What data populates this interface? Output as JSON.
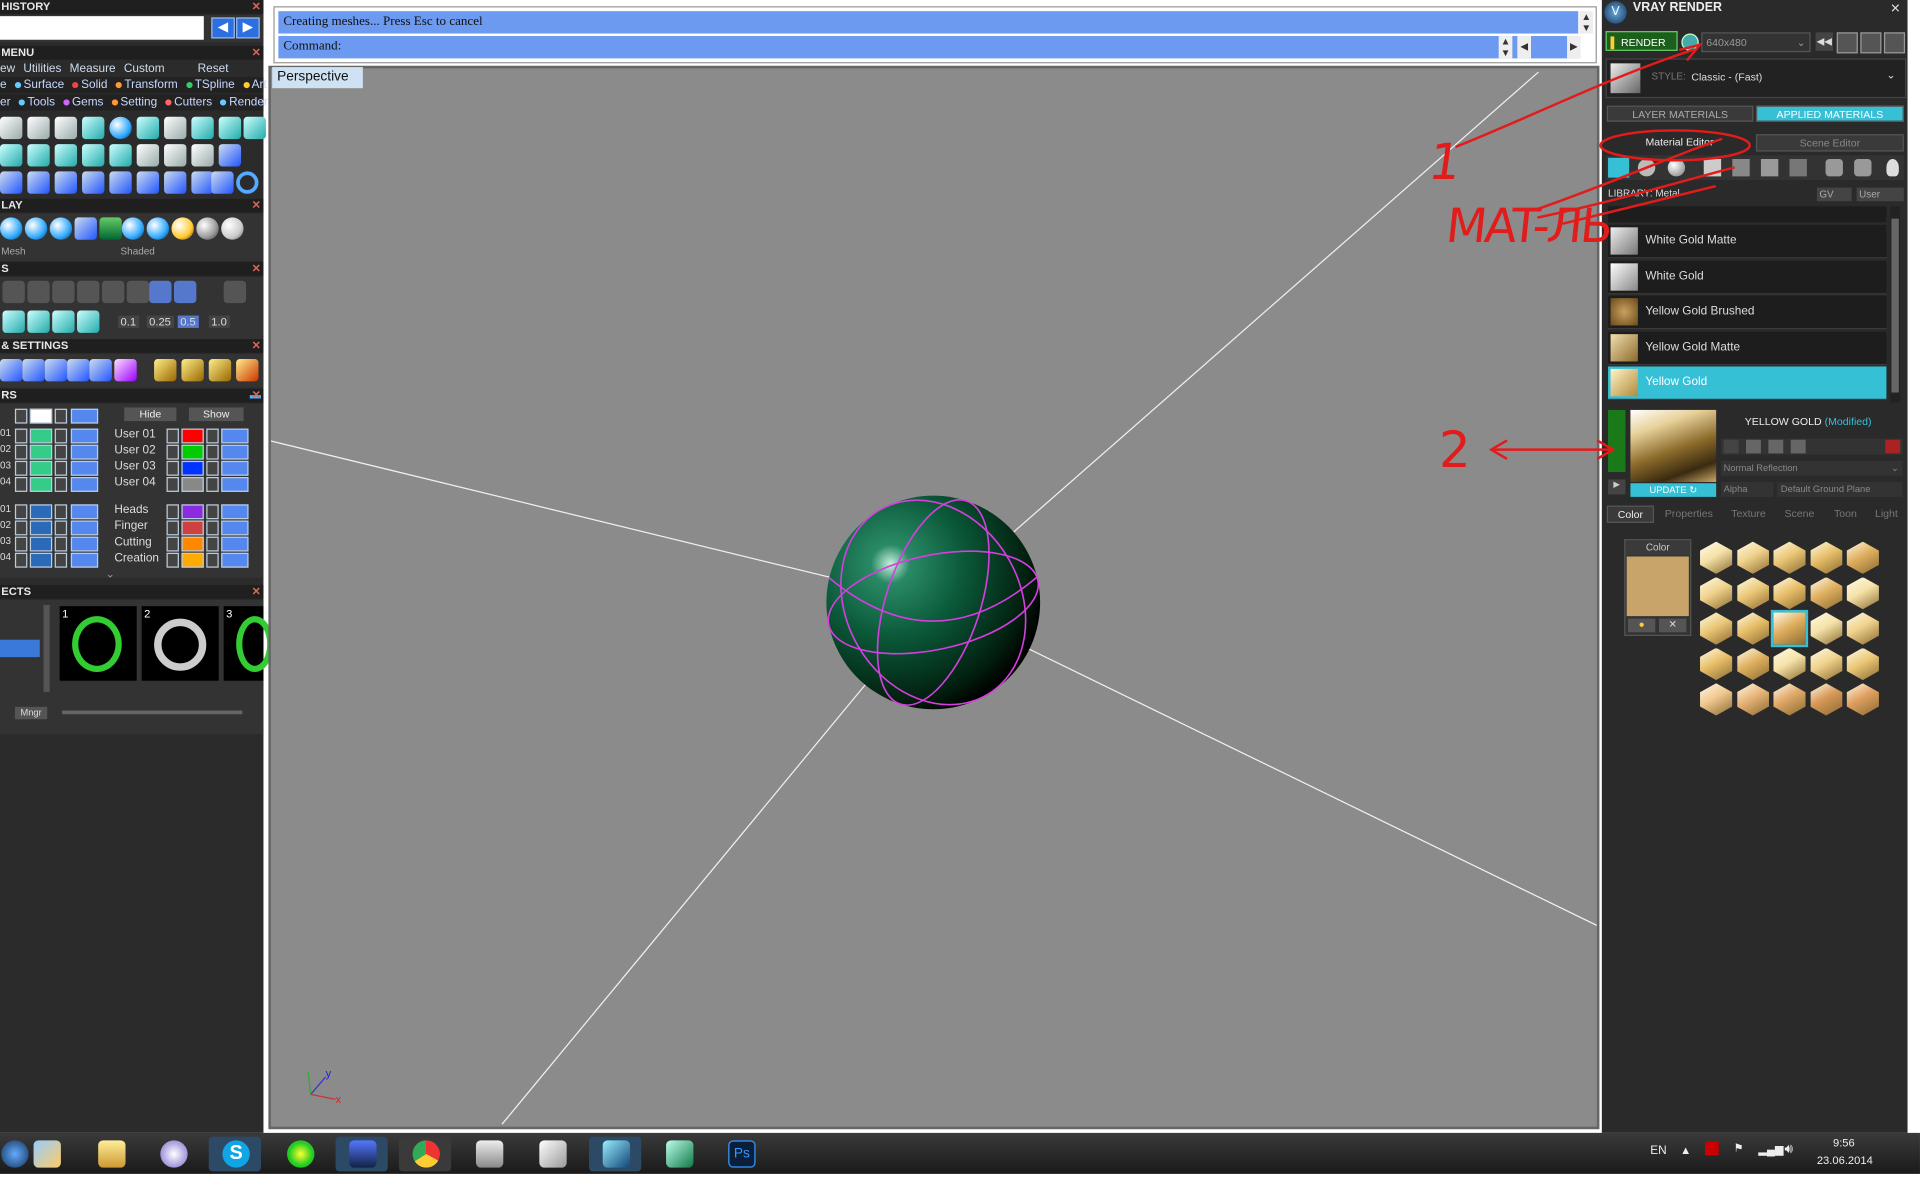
{
  "left_panel": {
    "history_title": "HISTORY",
    "menu_title": "MENU",
    "menu_row1": [
      "ew",
      "Utilities",
      "Measure",
      "Custom",
      "Reset"
    ],
    "menu_row2": [
      "e",
      "Surface",
      "Solid",
      "Transform",
      "TSpline",
      "Art"
    ],
    "menu_row3": [
      "er",
      "Tools",
      "Gems",
      "Setting",
      "Cutters",
      "Render"
    ],
    "display_title": "LAY",
    "display_mode1": "Mesh",
    "display_mode2": "Shaded",
    "snaps_title": "S",
    "snap_values": [
      "0.1",
      "0.25",
      "0.5",
      "1.0"
    ],
    "settings_title": "& SETTINGS",
    "layers_title": "RS",
    "hide_label": "Hide",
    "show_label": "Show",
    "layers": [
      {
        "num": "01",
        "name": "User 01",
        "color": "#ff0000"
      },
      {
        "num": "02",
        "name": "User 02",
        "color": "#00cc00"
      },
      {
        "num": "03",
        "name": "User 03",
        "color": "#0033ff"
      },
      {
        "num": "04",
        "name": "User 04",
        "color": "#888888"
      },
      {
        "num": "01",
        "name": "Heads",
        "color": "#8a2be2"
      },
      {
        "num": "02",
        "name": "Finger",
        "color": "#d04040"
      },
      {
        "num": "03",
        "name": "Cutting",
        "color": "#ff8800"
      },
      {
        "num": "04",
        "name": "Creation",
        "color": "#ffaa00"
      }
    ],
    "objects_title": "ECTS",
    "object_nums": [
      "1",
      "2",
      "3"
    ],
    "mngr_label": "Mngr"
  },
  "console": {
    "line1": "Creating meshes... Press Esc to cancel",
    "line2": "Command:"
  },
  "viewport": {
    "label": "Perspective",
    "axis_y": "y",
    "axis_x": "x"
  },
  "right_panel": {
    "title": "VRAY RENDER",
    "render_btn": "RENDER",
    "resolution": "640x480",
    "style_label": "STYLE:",
    "style_value": "Classic - (Fast)",
    "tab_layer_materials": "LAYER MATERIALS",
    "tab_applied_materials": "APPLIED MATERIALS",
    "tab_material_editor": "Material Editor",
    "tab_scene_editor": "Scene Editor",
    "library_label": "LIBRARY: Metal",
    "gv_label": "GV",
    "user_label": "User",
    "materials": [
      "White Gold Matte",
      "White Gold",
      "Yellow Gold Brushed",
      "Yellow Gold Matte",
      "Yellow Gold"
    ],
    "selected_material": "YELLOW GOLD",
    "modified_label": "(Modified)",
    "update_label": "UPDATE",
    "reflection_mode": "Normal Reflection",
    "alpha_label": "Alpha",
    "ground_plane": "Default Ground Plane",
    "prop_tabs": [
      "Color",
      "Properties",
      "Texture",
      "Scene",
      "Toon",
      "Light"
    ],
    "color_label": "Color",
    "color_swatch": "#c9a46a"
  },
  "taskbar": {
    "lang": "EN",
    "time": "9:56",
    "date": "23.06.2014"
  },
  "annotations": {
    "note1": "1",
    "note2": "2",
    "note3": "MAT-ЛЬ"
  },
  "colors": {
    "sphere": "#0b5a3a",
    "accent_cyan": "#36c0d6",
    "annotation_red": "#e21b1b"
  }
}
